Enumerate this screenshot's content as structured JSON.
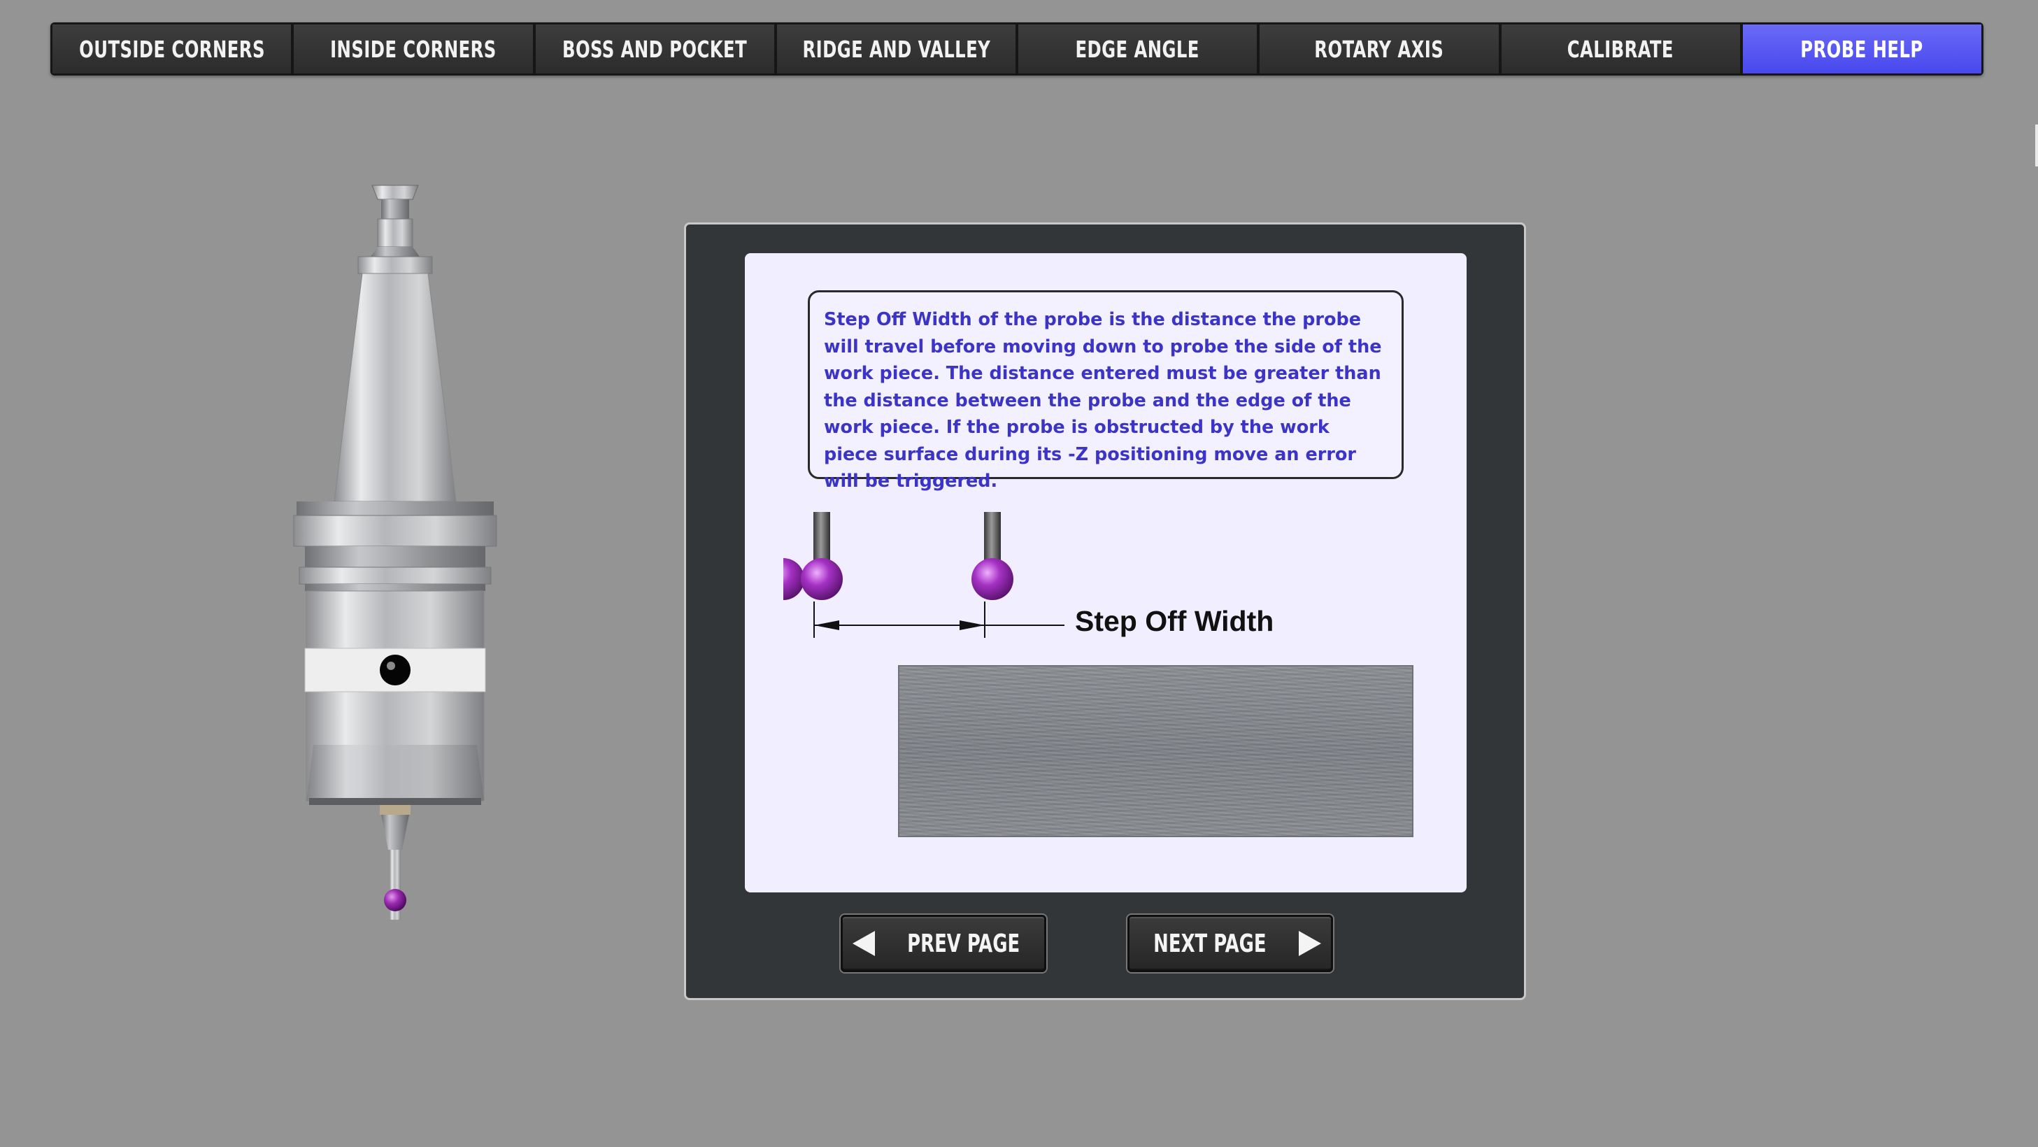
{
  "tabs": [
    {
      "label": "OUTSIDE CORNERS",
      "active": false
    },
    {
      "label": "INSIDE CORNERS",
      "active": false
    },
    {
      "label": "BOSS AND POCKET",
      "active": false
    },
    {
      "label": "RIDGE AND VALLEY",
      "active": false
    },
    {
      "label": "EDGE ANGLE",
      "active": false
    },
    {
      "label": "ROTARY AXIS",
      "active": false
    },
    {
      "label": "CALIBRATE",
      "active": false
    },
    {
      "label": "PROBE HELP",
      "active": true
    }
  ],
  "help": {
    "text": "Step Off Width of the probe is the distance the probe will travel before moving down to probe the side of the work piece. The distance entered must be greater than the distance between the probe and the edge of the work piece.  If the probe is obstructed by the work piece surface during its -Z positioning move an error will be triggered.",
    "diagram_label": "Step Off Width"
  },
  "nav": {
    "prev_label": "PREV PAGE",
    "next_label": "NEXT PAGE"
  },
  "icons": {
    "probe": "touch-probe-illustration",
    "stylus": "probe-stylus-icon",
    "prev": "arrow-left-icon",
    "next": "arrow-right-icon"
  },
  "colors": {
    "background": "#939493",
    "tab_active": "#5555f2",
    "help_text": "#3b34c6",
    "stylus_ball": "#8a1e9a"
  }
}
